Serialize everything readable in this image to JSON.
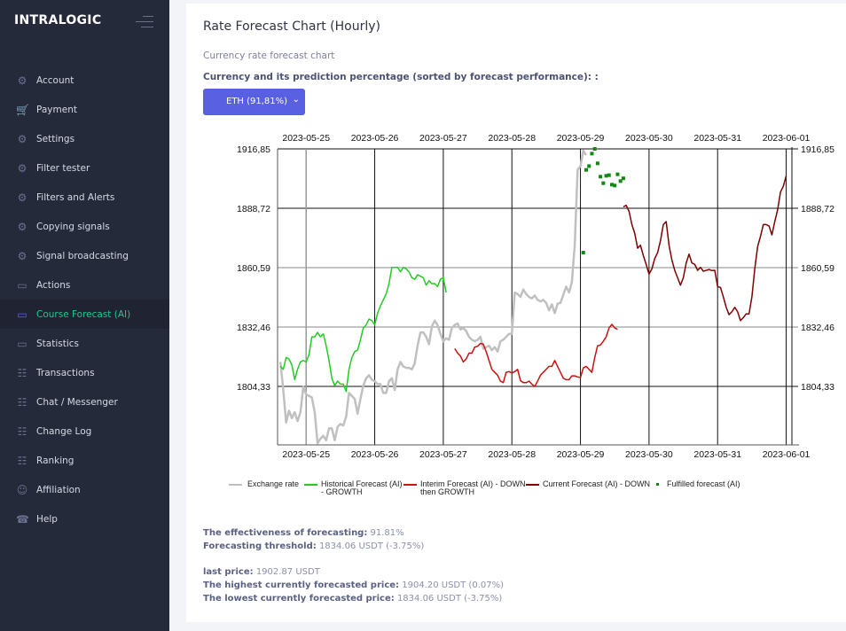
{
  "sidebar": {
    "logo": "INTRALOGIC",
    "items": [
      {
        "label": "Account",
        "icon": "gear-icon"
      },
      {
        "label": "Payment",
        "icon": "cart-icon"
      },
      {
        "label": "Settings",
        "icon": "gear-icon"
      },
      {
        "label": "Filter tester",
        "icon": "gear-icon"
      },
      {
        "label": "Filters and Alerts",
        "icon": "gear-icon"
      },
      {
        "label": "Copying signals",
        "icon": "gear-icon"
      },
      {
        "label": "Signal broadcasting",
        "icon": "gear-icon"
      },
      {
        "label": "Actions",
        "icon": "monitor-icon"
      },
      {
        "label": "Course Forecast (AI)",
        "icon": "monitor-icon",
        "active": true
      },
      {
        "label": "Statistics",
        "icon": "monitor-icon"
      },
      {
        "label": "Transactions",
        "icon": "database-icon"
      },
      {
        "label": "Chat / Messenger",
        "icon": "database-icon"
      },
      {
        "label": "Change Log",
        "icon": "database-icon"
      },
      {
        "label": "Ranking",
        "icon": "database-icon"
      },
      {
        "label": "Affiliation",
        "icon": "user-icon"
      },
      {
        "label": "Help",
        "icon": "phone-icon"
      }
    ]
  },
  "main": {
    "title": "Rate Forecast Chart (Hourly)",
    "subtitle": "Currency rate forecast chart",
    "select_label": "Currency and its prediction percentage (sorted by forecast performance): :",
    "select_value": "ETH (91,81%)",
    "accent_color": "#5a60e2"
  },
  "chart_data": {
    "type": "line",
    "x_ticks": [
      "2023-05-25",
      "2023-05-26",
      "2023-05-27",
      "2023-05-28",
      "2023-05-29",
      "2023-05-30",
      "2023-05-31",
      "2023-06-01"
    ],
    "y_ticks": [
      "1916,85",
      "1888,72",
      "1860,59",
      "1832,46",
      "1804,33"
    ],
    "y_tick_values": [
      1916.85,
      1888.72,
      1860.59,
      1832.46,
      1804.33
    ],
    "xlim": [
      "2023-05-24 14:00",
      "2023-06-01 02:00"
    ],
    "ylim": [
      1776.6,
      1916.85
    ],
    "grid": true,
    "legend_position": "bottom",
    "series": [
      {
        "name": "Exchange rate",
        "color": "#c0c0c0",
        "start": "2023-05-24 15:00",
        "step_hours": 1,
        "values": [
          1815.9,
          1802.6,
          1787.2,
          1792.8,
          1789.3,
          1792.1,
          1787.9,
          1792.1,
          1804.0,
          1800.5,
          1799.8,
          1799.1,
          1792.1,
          1777.4,
          1779.5,
          1780.9,
          1778.8,
          1784.4,
          1784.4,
          1778.8,
          1785.1,
          1786.5,
          1785.8,
          1790.0,
          1801.2,
          1799.8,
          1798.4,
          1791.4,
          1798.4,
          1804.7,
          1808.2,
          1809.6,
          1807.5,
          1806.8,
          1805.4,
          1805.4,
          1801.2,
          1801.2,
          1806.8,
          1808.2,
          1802.6,
          1812.4,
          1815.9,
          1813.8,
          1813.1,
          1813.1,
          1812.4,
          1815.2,
          1823.6,
          1829.9,
          1829.9,
          1827.8,
          1824.3,
          1832.7,
          1835.5,
          1833.4,
          1829.2,
          1825.7,
          1827.1,
          1826.4,
          1832.0,
          1833.4,
          1834.1,
          1831.3,
          1832.0,
          1830.6,
          1827.8,
          1826.4,
          1825.7,
          1826.4,
          1827.8,
          1822.2,
          1822.9,
          1823.6,
          1821.5,
          1822.9,
          1820.8,
          1825.7,
          1826.4,
          1827.8,
          1829.2,
          1829.2,
          1848.8,
          1848.1,
          1846.7,
          1850.2,
          1848.1,
          1846.7,
          1846.0,
          1847.4,
          1845.3,
          1844.6,
          1845.3,
          1843.9,
          1840.4,
          1843.2,
          1839.0,
          1843.5,
          1843.9,
          1847.7,
          1851.6,
          1848.8,
          1853.7,
          1871.2,
          1906.9,
          1908.7,
          1916.0,
          1913.9
        ]
      },
      {
        "name": "Historical Forecast (AI) - GROWTH",
        "color": "#22cc22",
        "start": "2023-05-24 15:00",
        "step_hours": 1,
        "values": [
          1813.8,
          1812.4,
          1818.0,
          1817.3,
          1814.5,
          1807.5,
          1812.4,
          1815.9,
          1816.6,
          1815.9,
          1819.4,
          1827.8,
          1827.8,
          1829.9,
          1827.8,
          1829.2,
          1823.6,
          1816.6,
          1808.2,
          1804.7,
          1806.8,
          1805.4,
          1805.4,
          1801.9,
          1812.4,
          1818.0,
          1820.8,
          1821.5,
          1826.4,
          1832.0,
          1833.4,
          1836.2,
          1835.5,
          1833.4,
          1839.0,
          1842.5,
          1845.3,
          1848.1,
          1853.0,
          1860.7,
          1860.7,
          1860.7,
          1858.6,
          1860.7,
          1860.0,
          1858.6,
          1855.8,
          1855.1,
          1857.2,
          1856.5,
          1855.8,
          1852.3,
          1854.4,
          1853.0,
          1853.0,
          1851.6,
          1855.1,
          1855.8,
          1848.8
        ]
      },
      {
        "name": "Interim Forecast (AI) - DOWN then GROWTH",
        "color": "#cc1111",
        "start": "2023-05-27 04:00",
        "step_hours": 1,
        "values": [
          1822.2,
          1820.1,
          1818.7,
          1815.9,
          1817.3,
          1820.1,
          1820.1,
          1822.9,
          1823.3,
          1824.7,
          1824.3,
          1820.8,
          1816.6,
          1812.4,
          1811.0,
          1809.6,
          1806.8,
          1806.1,
          1811.0,
          1811.3,
          1810.7,
          1811.3,
          1812.4,
          1807.1,
          1806.1,
          1806.1,
          1806.8,
          1805.4,
          1804.3,
          1806.8,
          1809.6,
          1811.0,
          1812.4,
          1813.8,
          1813.8,
          1816.6,
          1813.8,
          1811.0,
          1808.2,
          1807.5,
          1807.5,
          1809.3,
          1809.3,
          1808.8,
          1808.5,
          1813.1,
          1813.8,
          1812.4,
          1811.0,
          1818.0,
          1823.6,
          1823.9,
          1825.7,
          1827.8,
          1832.0,
          1833.7,
          1832.0,
          1831.3
        ]
      },
      {
        "name": "Current Forecast (AI) - DOWN",
        "color": "#800000",
        "start": "2023-05-29 15:00",
        "step_hours": 1,
        "values": [
          1889.4,
          1890.1,
          1887.3,
          1881.0,
          1876.8,
          1869.8,
          1871.2,
          1866.3,
          1862.1,
          1857.5,
          1860.0,
          1864.9,
          1867.7,
          1873.3,
          1881.0,
          1882.4,
          1871.2,
          1864.2,
          1859.3,
          1855.8,
          1852.3,
          1855.8,
          1862.8,
          1867.0,
          1862.8,
          1862.1,
          1859.3,
          1860.7,
          1858.9,
          1859.3,
          1859.7,
          1859.2,
          1859.3,
          1851.6,
          1851.2,
          1846.7,
          1841.8,
          1838.3,
          1839.7,
          1841.8,
          1839.7,
          1835.5,
          1836.9,
          1838.7,
          1838.7,
          1846.7,
          1860.0,
          1870.5,
          1875.4,
          1881.0,
          1881.0,
          1880.3,
          1876.1,
          1882.4,
          1888.0,
          1896.4,
          1899.2,
          1904.1
        ]
      },
      {
        "name": "Fulfilled forecast (AI)",
        "color": "#118811",
        "marker": "square",
        "start": "2023-05-29 01:00",
        "step_hours": 1,
        "values": [
          1867.7,
          1906.9,
          1908.7,
          1914.6,
          1916.85,
          1910.0,
          1903.7,
          1900.6,
          1904.1,
          1904.4,
          1899.9,
          1899.5,
          1904.8,
          1901.6,
          1902.9
        ]
      }
    ],
    "legend": [
      {
        "line1": "Exchange rate",
        "line2": ""
      },
      {
        "line1": "Historical Forecast (AI)",
        "line2": "- GROWTH"
      },
      {
        "line1": "Interim Forecast (AI) - DOWN",
        "line2": "then GROWTH"
      },
      {
        "line1": "Current Forecast (AI) - DOWN",
        "line2": ""
      },
      {
        "line1": "Fulfilled forecast (AI)",
        "line2": ""
      }
    ]
  },
  "stats": {
    "effectiveness_label": "The effectiveness of forecasting:",
    "effectiveness_value": "91.81%",
    "threshold_label": "Forecasting threshold:",
    "threshold_value": "1834.06 USDT (-3.75%)",
    "last_price_label": "last price:",
    "last_price_value": "1902.87 USDT",
    "highest_label": "The highest currently forecasted price:",
    "highest_value": "1904.20 USDT (0.07%)",
    "lowest_label": "The lowest currently forecasted price:",
    "lowest_value": "1834.06 USDT (-3.75%)"
  }
}
